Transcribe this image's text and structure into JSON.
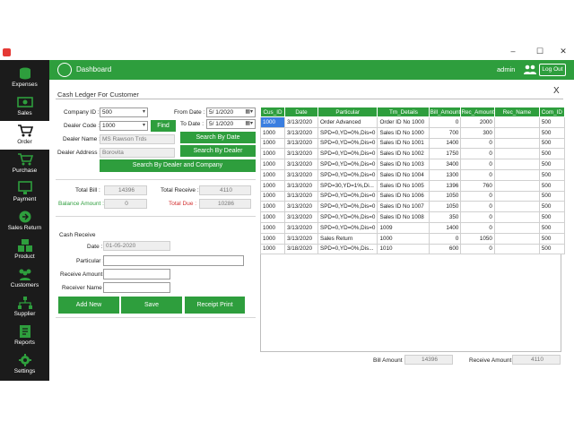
{
  "window": {
    "minimize": "–",
    "maximize": "☐",
    "close": "✕"
  },
  "sidebar": {
    "items": [
      {
        "label": "Expenses",
        "icon": "coins-icon"
      },
      {
        "label": "Sales",
        "icon": "cash-icon"
      },
      {
        "label": "Order",
        "icon": "cart-icon"
      },
      {
        "label": "Purchase",
        "icon": "cart-icon"
      },
      {
        "label": "Payment",
        "icon": "monitor-icon"
      },
      {
        "label": "Sales Return",
        "icon": "return-icon"
      },
      {
        "label": "Product",
        "icon": "boxes-icon"
      },
      {
        "label": "Customers",
        "icon": "people-icon"
      },
      {
        "label": "Supplier",
        "icon": "network-icon"
      },
      {
        "label": "Reports",
        "icon": "report-icon"
      },
      {
        "label": "Settings",
        "icon": "gear-icon"
      }
    ],
    "active": "Order"
  },
  "header": {
    "title": "Dashboard",
    "user": "admin",
    "logout": "Log Out"
  },
  "panel": {
    "title": "Cash Ledger For Customer",
    "close": "X"
  },
  "form": {
    "company_id_label": "Company ID :",
    "company_id_value": "500",
    "dealer_code_label": "Dealer Code :",
    "dealer_code_value": "1000",
    "find_button": "Find",
    "dealer_name_label": "Dealer Name :",
    "dealer_name_value": "MS Rawson Trds",
    "dealer_address_label": "Dealer Address :",
    "dealer_address_value": "Borovita",
    "from_date_label": "From Date :",
    "from_date_value": "5/ 1/2020",
    "to_date_label": "To Date :",
    "to_date_value": "5/ 1/2020",
    "search_by_date": "Search By Date",
    "search_by_dealer": "Search By Dealer",
    "search_by_dealer_company": "Search By Dealer and Company"
  },
  "summary": {
    "total_bill_label": "Total Bill :",
    "total_bill_value": "14396",
    "total_receive_label": "Total Receive :",
    "total_receive_value": "4110",
    "balance_amount_label": "Balance Amount :",
    "balance_amount_value": "0",
    "total_due_label": "Total Due :",
    "total_due_value": "10286"
  },
  "cash_receive": {
    "section_label": "Cash Receive",
    "date_label": "Date :",
    "date_value": "01-05-2020",
    "particular_label": "Particular :",
    "particular_value": "",
    "receive_amount_label": "Receive Amount :",
    "receive_amount_value": "",
    "receiver_name_label": "Receiver Name :",
    "receiver_name_value": "",
    "add_new": "Add New",
    "save": "Save",
    "receipt_print": "Receipt Print"
  },
  "table": {
    "columns": [
      "Cus_ID",
      "Date",
      "Particular",
      "Trn_Details",
      "Bill_Amount",
      "Rec_Amount",
      "Rec_Name",
      "Com_ID"
    ],
    "rows": [
      [
        "1000",
        "3/13/2020",
        "Order Advanced",
        "Order ID No 1000",
        "0",
        "2000",
        "",
        "500"
      ],
      [
        "1000",
        "3/13/2020",
        "SPD=0,YD=0%,Dis=0",
        "Sales ID No 1000",
        "700",
        "300",
        "",
        "500"
      ],
      [
        "1000",
        "3/13/2020",
        "SPD=0,YD=0%,Dis=0",
        "Sales ID No 1001",
        "1400",
        "0",
        "",
        "500"
      ],
      [
        "1000",
        "3/13/2020",
        "SPD=0,YD=0%,Dis=0",
        "Sales ID No 1002",
        "1750",
        "0",
        "",
        "500"
      ],
      [
        "1000",
        "3/13/2020",
        "SPD=0,YD=0%,Dis=0",
        "Sales ID No 1003",
        "3400",
        "0",
        "",
        "500"
      ],
      [
        "1000",
        "3/13/2020",
        "SPD=0,YD=0%,Dis=0",
        "Sales ID No 1004",
        "1300",
        "0",
        "",
        "500"
      ],
      [
        "1000",
        "3/13/2020",
        "SPD=30,YD=1%,Di...",
        "Sales ID No 1005",
        "1396",
        "760",
        "",
        "500"
      ],
      [
        "1000",
        "3/13/2020",
        "SPD=0,YD=0%,Dis=0",
        "Sales ID No 1006",
        "1050",
        "0",
        "",
        "500"
      ],
      [
        "1000",
        "3/13/2020",
        "SPD=0,YD=0%,Dis=0",
        "Sales ID No 1007",
        "1050",
        "0",
        "",
        "500"
      ],
      [
        "1000",
        "3/13/2020",
        "SPD=0,YD=0%,Dis=0",
        "Sales ID No 1008",
        "350",
        "0",
        "",
        "500"
      ],
      [
        "1000",
        "3/13/2020",
        "SPD=0,YD=0%,Dis=0",
        "1009",
        "1400",
        "0",
        "",
        "500"
      ],
      [
        "1000",
        "3/13/2020",
        "Sales Return",
        "1000",
        "0",
        "1050",
        "",
        "500"
      ],
      [
        "1000",
        "3/18/2020",
        "SPD=0,YD=0%,Dis...",
        "1010",
        "600",
        "0",
        "",
        "500"
      ]
    ]
  },
  "totals": {
    "bill_amount_label": "Bill Amount :",
    "bill_amount_value": "14396",
    "receive_amount_label": "Receive Amount :",
    "receive_amount_value": "4110"
  },
  "colors": {
    "accent": "#2e9e3d",
    "sidebar": "#1b1b1b",
    "due": "#d32f2f",
    "balance": "#2e9e3d",
    "selected": "#3a7ee0"
  }
}
